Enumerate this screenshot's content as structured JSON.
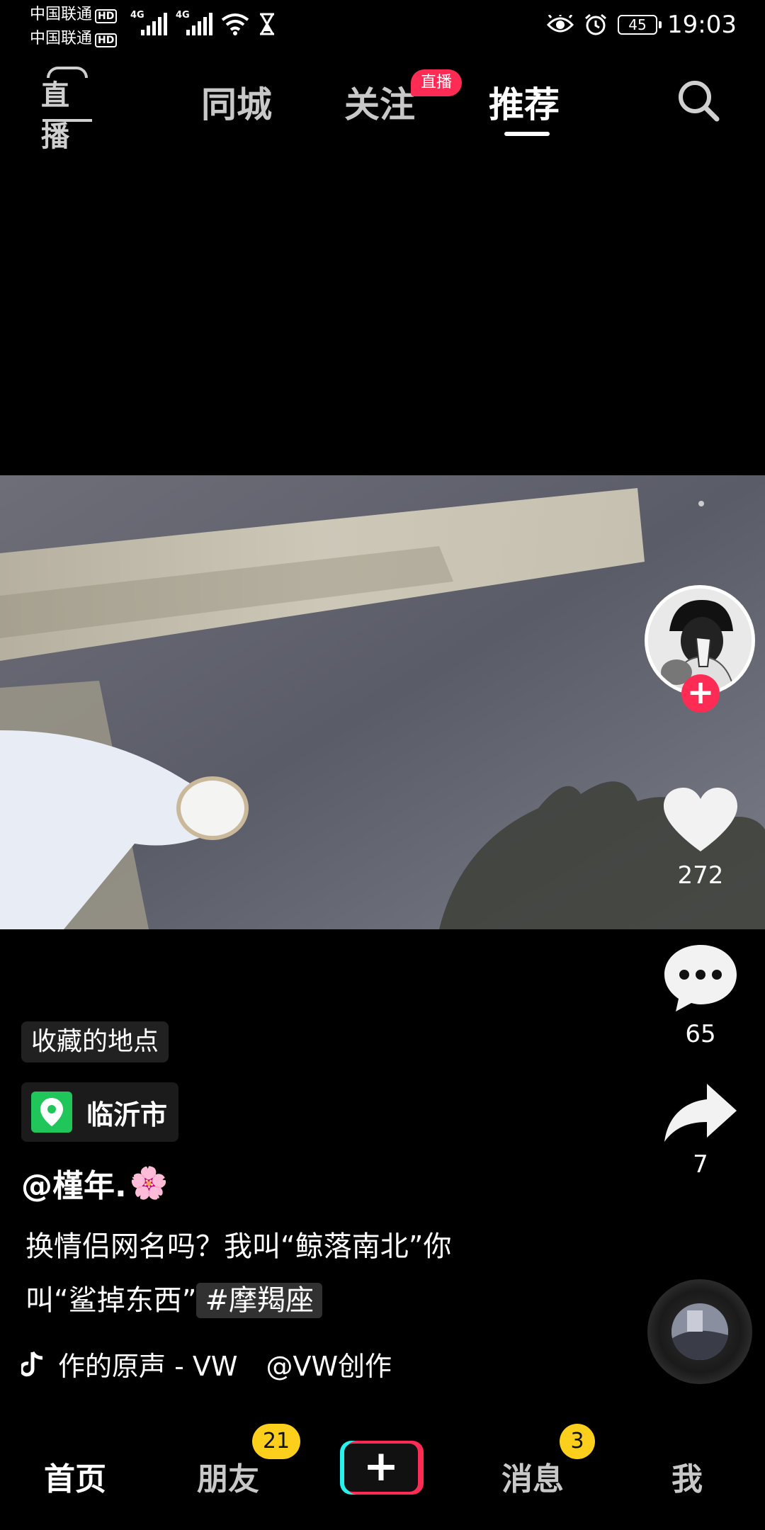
{
  "status_bar": {
    "carrier1": "中国联通",
    "carrier2": "中国联通",
    "hd_label": "HD",
    "network1": "4G",
    "network2": "4G",
    "battery": "45",
    "time": "19:03"
  },
  "top_nav": {
    "live_label": "直播",
    "tabs": [
      {
        "label": "同城"
      },
      {
        "label": "关注",
        "badge": "直播"
      },
      {
        "label": "推荐",
        "selected": true
      }
    ]
  },
  "right_rail": {
    "likes": "272",
    "comments": "65",
    "shares": "7"
  },
  "post": {
    "saved_tag": "收藏的地点",
    "location": "临沂市",
    "author": "@槿年.",
    "author_emoji": "🌸",
    "desc_line1": "换情侣网名吗？我叫“鲸落南北”你",
    "desc_line2": "叫“鲨掉东西”",
    "hashtag": "#摩羯座",
    "music_title": "作的原声 - VW",
    "music_author": "@VW创作"
  },
  "bottom_nav": {
    "home": "首页",
    "friends": "朋友",
    "friends_badge": "21",
    "create": "+",
    "messages": "消息",
    "messages_badge": "3",
    "me": "我"
  },
  "colors": {
    "accent": "#fe2c55",
    "badge": "#fccf1c",
    "location_green": "#21c65a"
  }
}
